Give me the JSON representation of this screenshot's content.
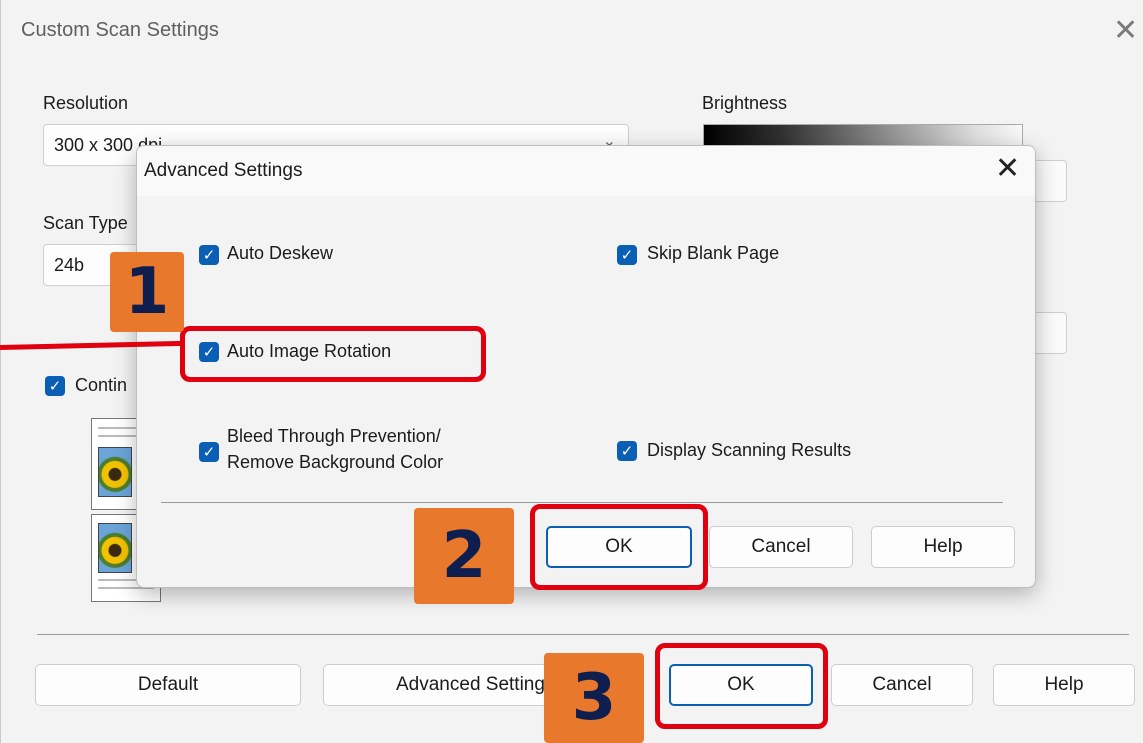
{
  "main_window": {
    "title": "Custom Scan Settings",
    "close_glyph": "✕",
    "resolution": {
      "label": "Resolution",
      "value": "300 x 300 dpi"
    },
    "scan_type": {
      "label": "Scan Type",
      "value": "24b"
    },
    "brightness": {
      "label": "Brightness"
    },
    "continuous": {
      "label": "Contin",
      "checked": true
    },
    "buttons": {
      "default": "Default",
      "advanced": "Advanced Settings",
      "ok": "OK",
      "cancel": "Cancel",
      "help": "Help"
    }
  },
  "advanced_dialog": {
    "title": "Advanced Settings",
    "close_glyph": "✕",
    "options": {
      "auto_deskew": {
        "label": "Auto Deskew",
        "checked": true
      },
      "skip_blank_page": {
        "label": "Skip Blank Page",
        "checked": true
      },
      "auto_image_rotation": {
        "label": "Auto Image Rotation",
        "checked": true
      },
      "bleed_through_line1": "Bleed Through Prevention/",
      "bleed_through_line2": "Remove Background Color",
      "display_results": {
        "label": "Display Scanning Results",
        "checked": true
      }
    },
    "buttons": {
      "ok": "OK",
      "cancel": "Cancel",
      "help": "Help"
    }
  },
  "annotations": {
    "step1": "1",
    "step2": "2",
    "step3": "3"
  },
  "icons": {
    "check": "check-icon",
    "close": "close-icon",
    "chevron": "chevron-down-icon"
  },
  "colors": {
    "accent": "#0a5fb4",
    "highlight": "#e0000f",
    "callout": "#e8782c",
    "callout_text": "#0d1e4f"
  }
}
